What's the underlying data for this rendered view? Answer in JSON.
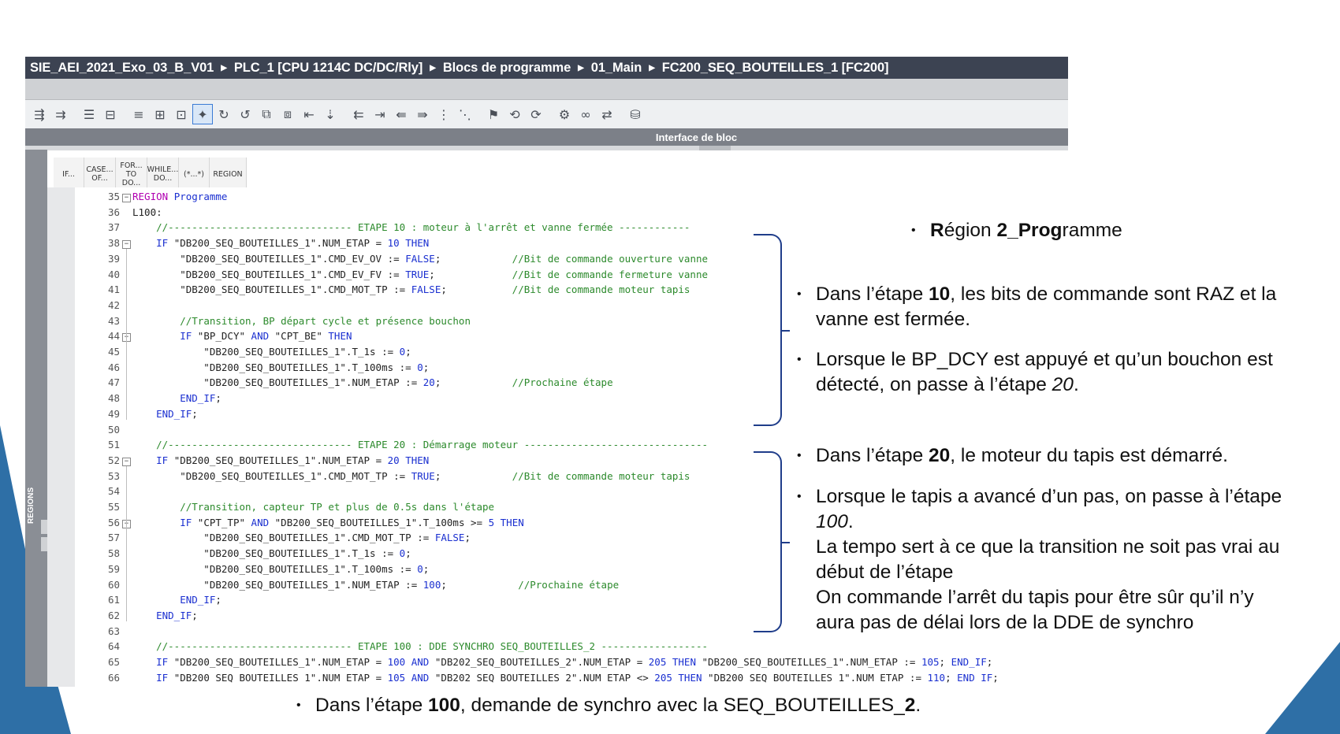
{
  "breadcrumb": [
    "SIE_AEI_2021_Exo_03_B_V01",
    "PLC_1 [CPU 1214C DC/DC/Rly]",
    "Blocs de programme",
    "01_Main",
    "FC200_SEQ_BOUTEILLES_1 [FC200]"
  ],
  "interface_label": "Interface de bloc",
  "instructions": [
    "IF...",
    "CASE... OF...",
    "FOR... TO DO...",
    "WHILE... DO...",
    "(*...*)",
    "REGION"
  ],
  "regions_label": "REGIONS",
  "code_lines": [
    {
      "n": "35",
      "t": "REGION Programme"
    },
    {
      "n": "36",
      "t": "L100:"
    },
    {
      "n": "37",
      "t": "    //------------------------------- ETAPE 10 : moteur à l'arrêt et vanne fermée ------------"
    },
    {
      "n": "38",
      "t": "    IF \"DB200_SEQ_BOUTEILLES_1\".NUM_ETAP = 10 THEN"
    },
    {
      "n": "39",
      "t": "        \"DB200_SEQ_BOUTEILLES_1\".CMD_EV_OV := FALSE;            //Bit de commande ouverture vanne"
    },
    {
      "n": "40",
      "t": "        \"DB200_SEQ_BOUTEILLES_1\".CMD_EV_FV := TRUE;             //Bit de commande fermeture vanne"
    },
    {
      "n": "41",
      "t": "        \"DB200_SEQ_BOUTEILLES_1\".CMD_MOT_TP := FALSE;           //Bit de commande moteur tapis"
    },
    {
      "n": "42",
      "t": ""
    },
    {
      "n": "43",
      "t": "        //Transition, BP départ cycle et présence bouchon"
    },
    {
      "n": "44",
      "t": "        IF \"BP_DCY\" AND \"CPT_BE\" THEN"
    },
    {
      "n": "45",
      "t": "            \"DB200_SEQ_BOUTEILLES_1\".T_1s := 0;"
    },
    {
      "n": "46",
      "t": "            \"DB200_SEQ_BOUTEILLES_1\".T_100ms := 0;"
    },
    {
      "n": "47",
      "t": "            \"DB200_SEQ_BOUTEILLES_1\".NUM_ETAP := 20;            //Prochaine étape"
    },
    {
      "n": "48",
      "t": "        END_IF;"
    },
    {
      "n": "49",
      "t": "    END_IF;"
    },
    {
      "n": "50",
      "t": ""
    },
    {
      "n": "51",
      "t": "    //------------------------------- ETAPE 20 : Démarrage moteur -------------------------------"
    },
    {
      "n": "52",
      "t": "    IF \"DB200_SEQ_BOUTEILLES_1\".NUM_ETAP = 20 THEN"
    },
    {
      "n": "53",
      "t": "        \"DB200_SEQ_BOUTEILLES_1\".CMD_MOT_TP := TRUE;            //Bit de commande moteur tapis"
    },
    {
      "n": "54",
      "t": ""
    },
    {
      "n": "55",
      "t": "        //Transition, capteur TP et plus de 0.5s dans l'étape"
    },
    {
      "n": "56",
      "t": "        IF \"CPT_TP\" AND \"DB200_SEQ_BOUTEILLES_1\".T_100ms >= 5 THEN"
    },
    {
      "n": "57",
      "t": "            \"DB200_SEQ_BOUTEILLES_1\".CMD_MOT_TP := FALSE;"
    },
    {
      "n": "58",
      "t": "            \"DB200_SEQ_BOUTEILLES_1\".T_1s := 0;"
    },
    {
      "n": "59",
      "t": "            \"DB200_SEQ_BOUTEILLES_1\".T_100ms := 0;"
    },
    {
      "n": "60",
      "t": "            \"DB200_SEQ_BOUTEILLES_1\".NUM_ETAP := 100;            //Prochaine étape"
    },
    {
      "n": "61",
      "t": "        END_IF;"
    },
    {
      "n": "62",
      "t": "    END_IF;"
    },
    {
      "n": "63",
      "t": ""
    },
    {
      "n": "64",
      "t": "    //------------------------------- ETAPE 100 : DDE SYNCHRO SEQ_BOUTEILLES_2 ------------------"
    },
    {
      "n": "65",
      "t": "    IF \"DB200_SEQ_BOUTEILLES_1\".NUM_ETAP = 100 AND \"DB202_SEQ_BOUTEILLES_2\".NUM_ETAP = 205 THEN \"DB200_SEQ_BOUTEILLES_1\".NUM_ETAP := 105; END_IF;"
    },
    {
      "n": "66",
      "t": "    IF \"DB200 SEQ BOUTEILLES 1\".NUM ETAP = 105 AND \"DB202 SEQ BOUTEILLES 2\".NUM ETAP <> 205 THEN \"DB200 SEQ BOUTEILLES 1\".NUM ETAP := 110; END IF;"
    }
  ],
  "annotations": {
    "region_title": {
      "b1": "R",
      "n1": "égion ",
      "b2": "2_Prog",
      "n2": "ramme"
    },
    "etape10_a": {
      "pre": "Dans l’étape ",
      "bold": "10",
      "post": ", les bits de commande sont RAZ et la vanne est fermée."
    },
    "etape10_b": {
      "pre": "Lorsque le BP_DCY est appuyé et qu’un bouchon est détecté, on passe à l’étape ",
      "ital": "20",
      "post": "."
    },
    "etape20_a": {
      "pre": "Dans l’étape ",
      "bold": "20",
      "post": ", le moteur du tapis est démarré."
    },
    "etape20_b": {
      "line1": "Lorsque le tapis a avancé d’un pas, on passe à l’étape ",
      "ital": "100",
      "post": ".",
      "line2": "La tempo sert à ce que la transition ne soit pas vrai au début de l’étape",
      "line3": "On commande l’arrêt du tapis pour être sûr qu’il n’y aura pas de délai lors de la DDE de synchro"
    },
    "etape100": {
      "pre": "Dans l’étape ",
      "bold": "100",
      "mid": ", demande de synchro avec la SEQ_BOUTEILLES_",
      "bold2": "2",
      "post": "."
    }
  },
  "colors": {
    "keyword": "#1a2fd0",
    "comment": "#2c8a2c",
    "region": "#b100b1",
    "bracket": "#1f3d8a",
    "accent": "#2e6fa6"
  },
  "toolbar_icons": [
    "insert-network-icon",
    "delete-network-icon",
    "insert-row-icon",
    "delete-row-icon",
    "open-all-icon",
    "close-all-icon",
    "indent-icon",
    "outdent-icon",
    "comment-icon",
    "uncomment-icon",
    "monitor-icon",
    "snapshot-icon",
    "compare-icon",
    "download-icon",
    "breakpoint-icon",
    "step-icon"
  ]
}
